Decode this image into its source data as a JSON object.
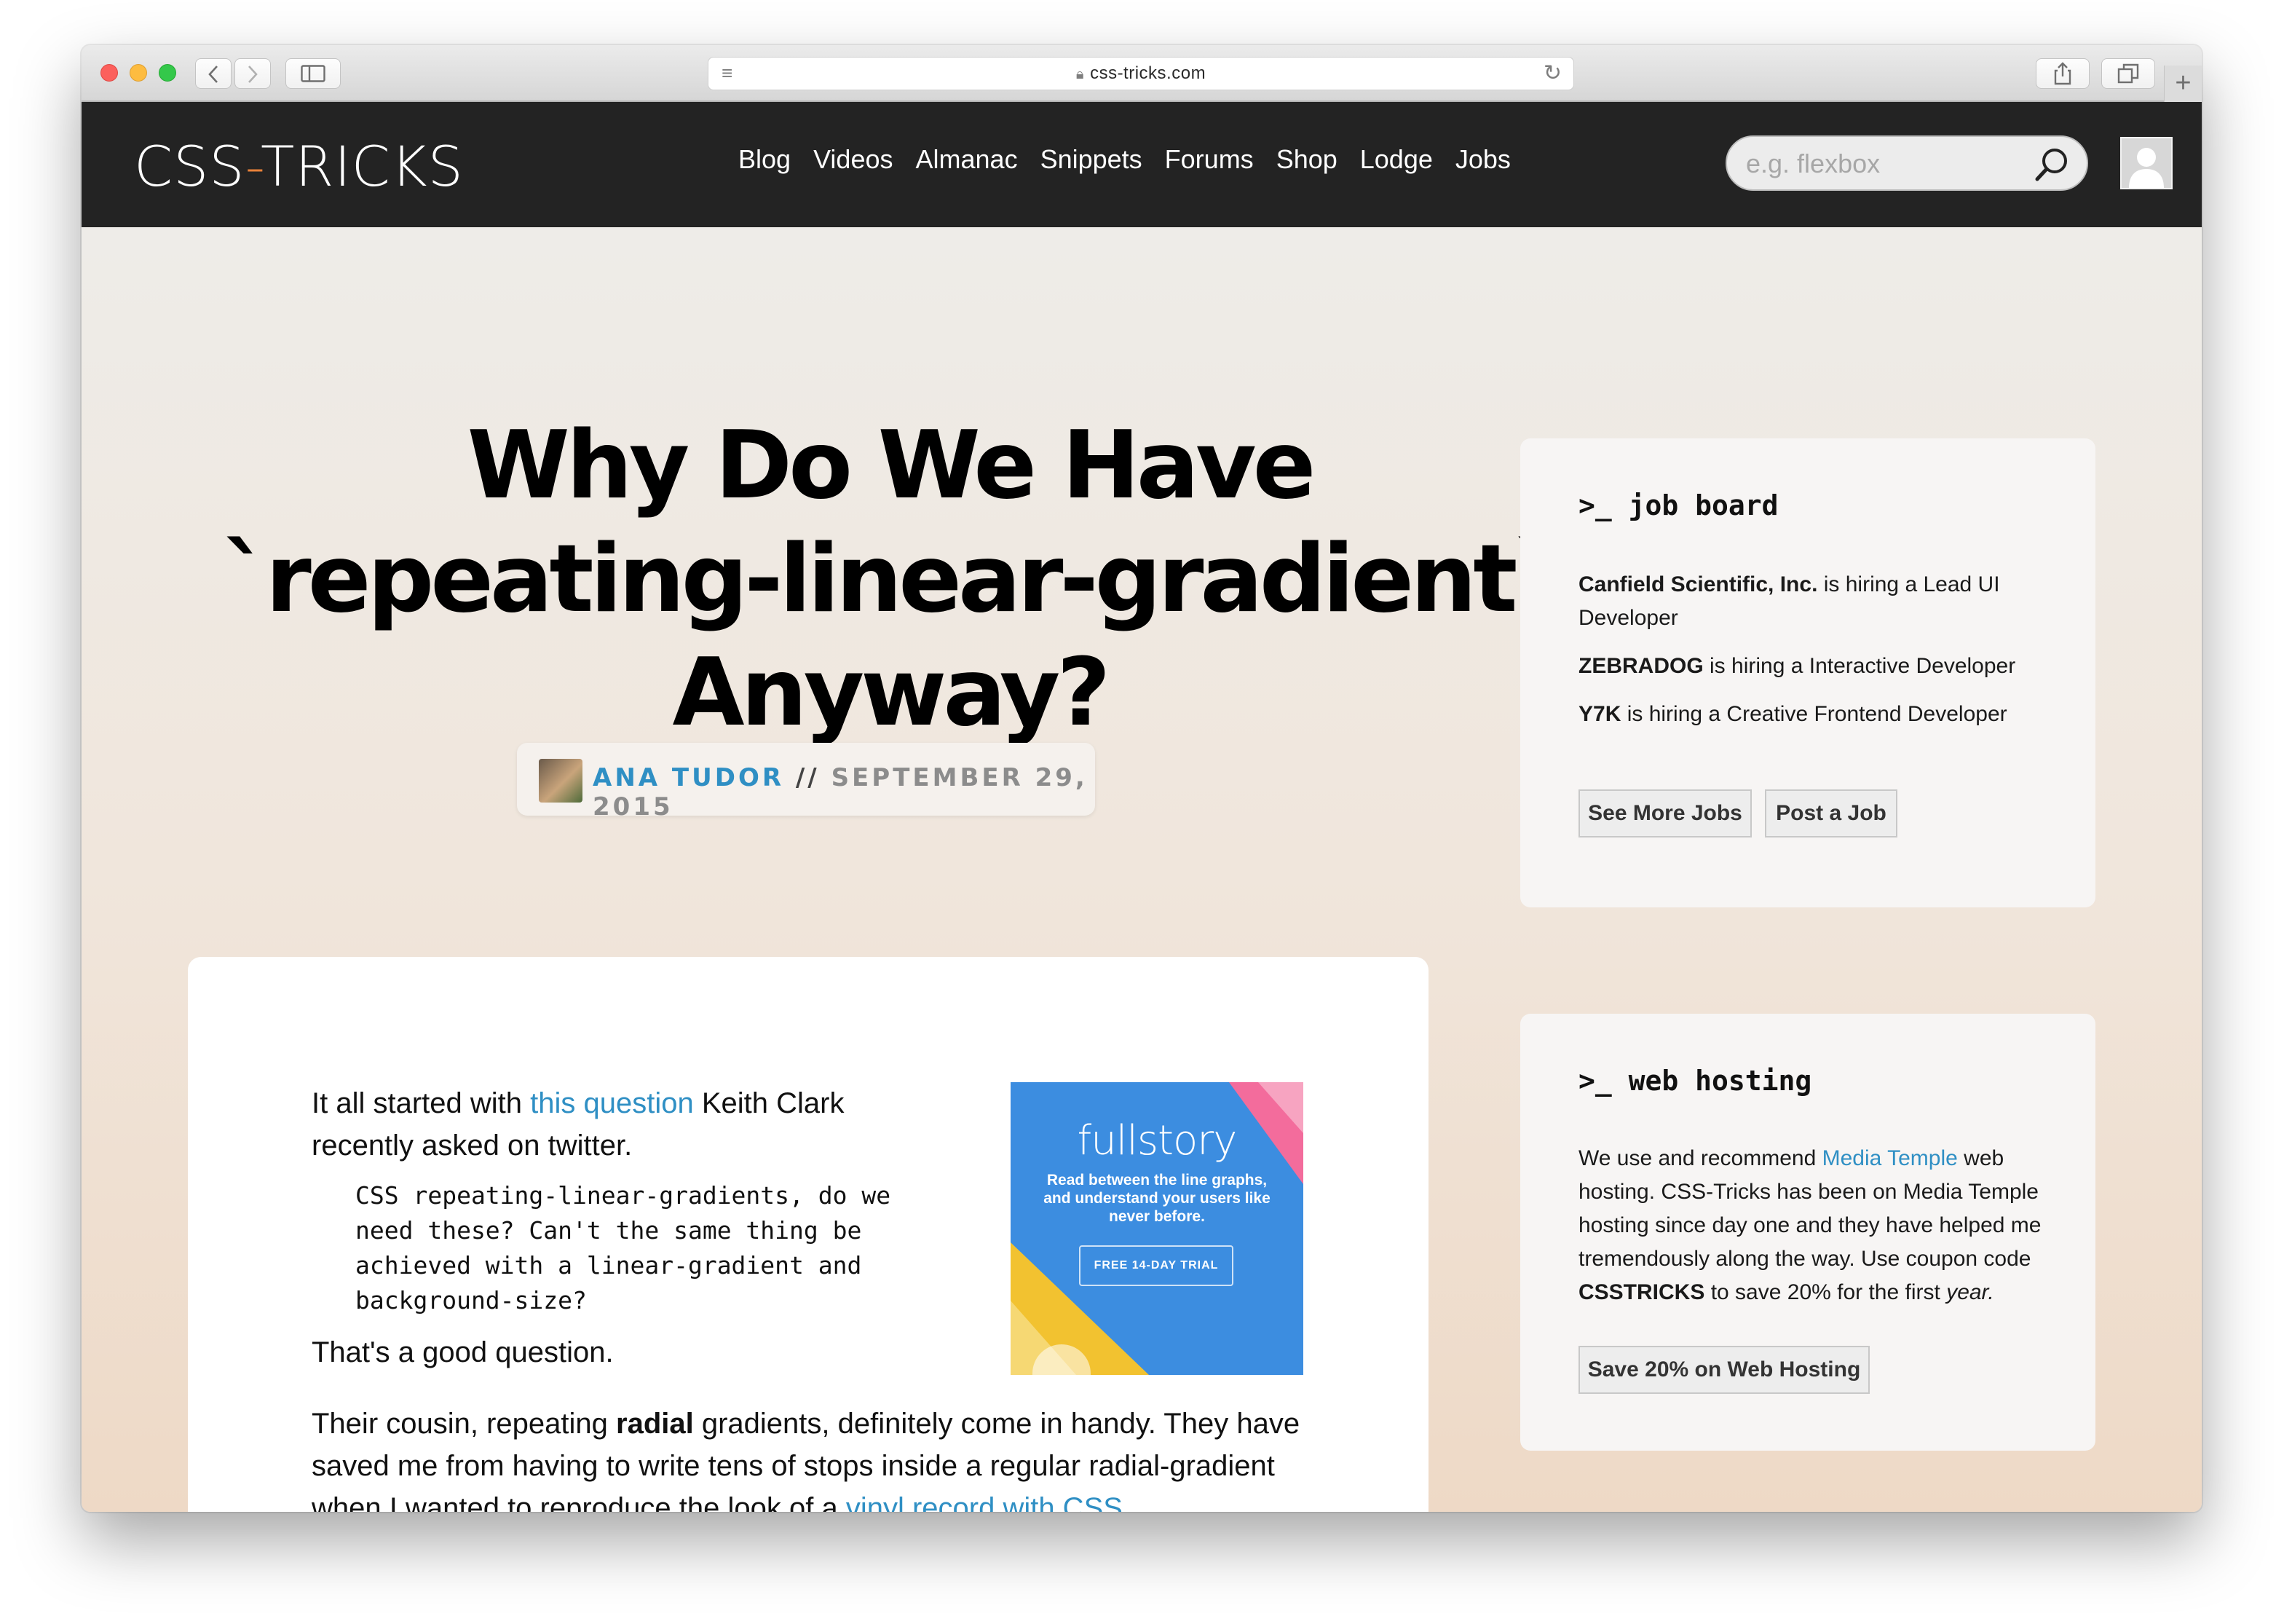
{
  "browser": {
    "url": "css-tricks.com",
    "new_tab_glyph": "+"
  },
  "site": {
    "logo_left": "CSS",
    "logo_dash": "-",
    "logo_right": "TRICKS",
    "nav": [
      "Blog",
      "Videos",
      "Almanac",
      "Snippets",
      "Forums",
      "Shop",
      "Lodge",
      "Jobs"
    ],
    "search_placeholder": "e.g. flexbox"
  },
  "article": {
    "title_line1": "Why Do We Have",
    "title_line2": "`repeating-linear-gradient`",
    "title_line3": "Anyway?",
    "author": "ANA TUDOR",
    "separator": "//",
    "date": "SEPTEMBER 29, 2015",
    "p1_before": "It all started with ",
    "p1_link": "this question",
    "p1_after": " Keith Clark recently asked on twitter.",
    "quote": "CSS repeating-linear-gradients, do we need these? Can't the same thing be achieved with a linear-gradient and background-size?",
    "p2": "That's a good question.",
    "p3_a": "Their cousin, repeating ",
    "p3_bold": "radial",
    "p3_b": " gradients, definitely come in handy. They have saved me from having to write tens of stops inside a regular radial-gradient when I wanted to reproduce the look of a ",
    "p3_link": "vinyl record with CSS",
    "p3_c": "."
  },
  "ad": {
    "brand": "fullstory",
    "copy": "Read between the line graphs, and understand your users like never before.",
    "cta": "FREE 14-DAY TRIAL",
    "colors": {
      "background": "#3c8de0",
      "yellow": "#f2c230",
      "pink": "#f36c9c"
    }
  },
  "sidebar": {
    "jobs": {
      "title": ">_ job board",
      "items": [
        {
          "company": "Canfield Scientific, Inc.",
          "text": " is hiring a Lead UI Developer"
        },
        {
          "company": "ZEBRADOG",
          "text": " is hiring a Interactive Developer"
        },
        {
          "company": "Y7K",
          "text": " is hiring a Creative Frontend Developer"
        }
      ],
      "more_button": "See More Jobs",
      "post_button": "Post a Job"
    },
    "hosting": {
      "title": ">_ web hosting",
      "text_a": "We use and recommend ",
      "link": "Media Temple",
      "text_b": " web hosting. CSS-Tricks has been on Media Temple hosting since day one and they have helped me tremendously along the way. Use coupon code ",
      "code": "CSSTRICKS",
      "text_c": " to save 20% for the first ",
      "text_em": "year.",
      "button": "Save 20% on Web Hosting"
    }
  },
  "colors": {
    "header_bg": "#232323",
    "logo_dash": "#e8813a",
    "link": "#2f8fc4"
  }
}
